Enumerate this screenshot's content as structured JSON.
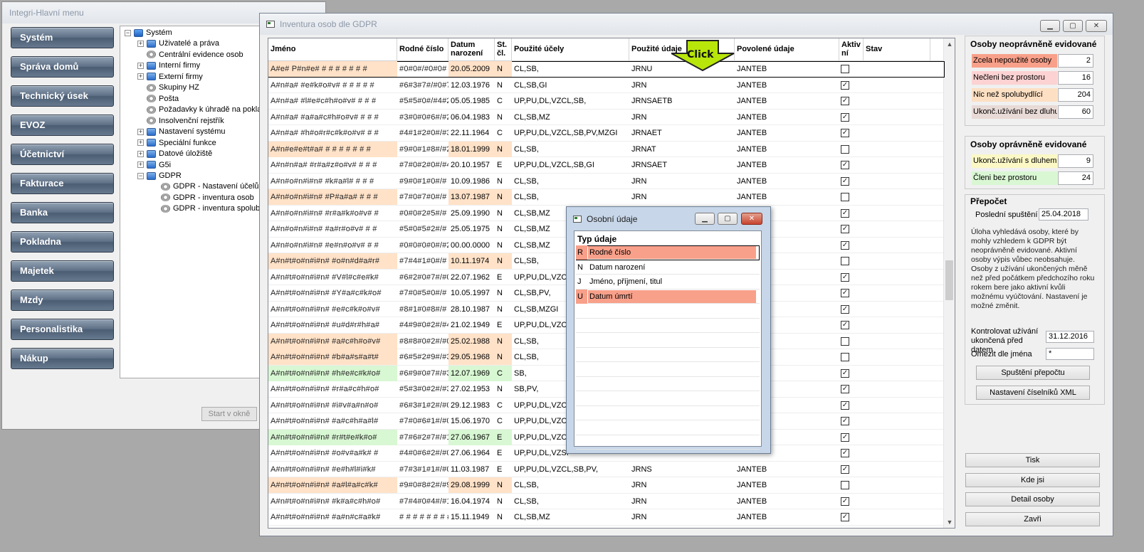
{
  "main_window": {
    "title": "Integri-Hlavní menu",
    "nav_buttons": [
      "Systém",
      "Správa domů",
      "Technický úsek",
      "EVOZ",
      "Účetnictví",
      "Fakturace",
      "Banka",
      "Pokladna",
      "Majetek",
      "Mzdy",
      "Personalistika",
      "Nákup"
    ],
    "tree": {
      "root": "Systém",
      "items": [
        "Uživatelé a práva",
        "Centrální evidence osob",
        "Interní firmy",
        "Externí firmy",
        "Skupiny HZ",
        "Pošta",
        "Požadavky k úhradě na pokla",
        "Insolvenční rejstřík",
        "Nastavení systému",
        "Speciální funkce",
        "Datové úložiště",
        "G5i",
        "GDPR"
      ],
      "gdpr_children": [
        "GDPR - Nastavení účelů",
        "GDPR - inventura osob",
        "GDPR - inventura spoluby"
      ]
    },
    "start_button": "Start v okně"
  },
  "gdpr_window": {
    "title": "Inventura osob dle GDPR",
    "columns": {
      "jmeno": "Jméno",
      "rodne_cislo": "Rodné číslo",
      "datum_narozeni": "Datum\nnarození",
      "st_cl": "St.\nčl.",
      "pouzite_ucely": "Použité účely",
      "pouzite_udaje": "Použité údaje",
      "povolene_udaje": "Povolené údaje",
      "aktivni": "Aktiv\nní",
      "stav": "Stav"
    },
    "rows": [
      {
        "jmeno": "A#e# P#n#e# # # # # # # #",
        "rc": "#0#0#/#0#0#",
        "datum": "20.05.2009",
        "st": "N",
        "ucely": "CL,SB,",
        "udaje": "JRNU",
        "povolene": "JANTEB",
        "aktivni": false,
        "bg": "orange"
      },
      {
        "jmeno": "A#n#a# #e#k#o#v# # # # # #",
        "rc": "#6#3#7#/#0#7#",
        "datum": "12.03.1976",
        "st": "N",
        "ucely": "CL,SB,GI",
        "udaje": "JRN",
        "povolene": "JANTEB",
        "aktivni": true,
        "bg": ""
      },
      {
        "jmeno": "A#n#a# #l#e#c#h#o#v# # # #",
        "rc": "#5#5#0#/#4#2#",
        "datum": "05.05.1985",
        "st": "C",
        "ucely": "UP,PU,DL,VZCL,SB,",
        "udaje": "JRNSAETB",
        "povolene": "JANTEB",
        "aktivni": true,
        "bg": ""
      },
      {
        "jmeno": "A#n#a# #a#a#c#h#o#v# # # #",
        "rc": "#3#0#0#6#/#2#3#",
        "datum": "06.04.1983",
        "st": "N",
        "ucely": "CL,SB,MZ",
        "udaje": "JRN",
        "povolene": "JANTEB",
        "aktivni": true,
        "bg": ""
      },
      {
        "jmeno": "A#n#a# #h#o#r#c#k#o#v# # #",
        "rc": "#4#1#2#0#/#3#1#",
        "datum": "22.11.1964",
        "st": "C",
        "ucely": "UP,PU,DL,VZCL,SB,PV,MZGI",
        "udaje": "JRNAET",
        "povolene": "JANTEB",
        "aktivni": true,
        "bg": ""
      },
      {
        "jmeno": "A#n#e#e#t#a# # # # # # # #",
        "rc": "#9#0#1#8#/#2#9#",
        "datum": "18.01.1999",
        "st": "N",
        "ucely": "CL,SB,",
        "udaje": "JRNAT",
        "povolene": "JANTEB",
        "aktivni": false,
        "bg": "orange"
      },
      {
        "jmeno": "A#n#n#a# #r#a#z#o#v# # # #",
        "rc": "#7#0#2#0#/#4#9#",
        "datum": "20.10.1957",
        "st": "E",
        "ucely": "UP,PU,DL,VZCL,SB,GI",
        "udaje": "JRNSAET",
        "povolene": "JANTEB",
        "aktivni": true,
        "bg": ""
      },
      {
        "jmeno": "A#n#o#n#i#n# #k#a#l# # # #",
        "rc": "#9#0#1#0#/# # #",
        "datum": "10.09.1986",
        "st": "N",
        "ucely": "CL,SB,",
        "udaje": "JRN",
        "povolene": "JANTEB",
        "aktivni": true,
        "bg": ""
      },
      {
        "jmeno": "A#n#o#n#i#n# #P#a#a# # # #",
        "rc": "#7#0#7#0#/# # #",
        "datum": "13.07.1987",
        "st": "N",
        "ucely": "CL,SB,",
        "udaje": "JRN",
        "povolene": "JANTEB",
        "aktivni": false,
        "bg": "orange"
      },
      {
        "jmeno": "A#n#o#n#i#n# #r#a#k#o#v# #",
        "rc": "#0#0#2#5#/# # #",
        "datum": "25.09.1990",
        "st": "N",
        "ucely": "CL,SB,MZ",
        "udaje": "",
        "povolene": "",
        "aktivni": true,
        "bg": ""
      },
      {
        "jmeno": "A#n#o#n#i#n# #a#r#o#v# # #",
        "rc": "#5#0#5#2#/# # #",
        "datum": "25.05.1975",
        "st": "N",
        "ucely": "CL,SB,MZ",
        "udaje": "",
        "povolene": "",
        "aktivni": true,
        "bg": ""
      },
      {
        "jmeno": "A#n#o#n#i#n# #e#n#o#v# # #",
        "rc": "#0#0#0#0#/#2#3#",
        "datum": "00.00.0000",
        "st": "N",
        "ucely": "CL,SB,MZ",
        "udaje": "",
        "povolene": "",
        "aktivni": true,
        "bg": ""
      },
      {
        "jmeno": "A#n#t#o#n#i#n# #o#n#d#a#r#",
        "rc": "#7#4#1#0#/# # #",
        "datum": "10.11.1974",
        "st": "N",
        "ucely": "CL,SB,",
        "udaje": "",
        "povolene": "",
        "aktivni": false,
        "bg": "orange"
      },
      {
        "jmeno": "A#n#t#o#n#i#n# #V#l#c#e#k#",
        "rc": "#6#2#0#7#/#0#4#",
        "datum": "22.07.1962",
        "st": "E",
        "ucely": "UP,PU,DL,VZCL",
        "udaje": "",
        "povolene": "",
        "aktivni": true,
        "bg": ""
      },
      {
        "jmeno": "A#n#t#o#n#i#n# #Y#a#c#k#o#",
        "rc": "#7#0#5#0#/# # #",
        "datum": "10.05.1997",
        "st": "N",
        "ucely": "CL,SB,PV,",
        "udaje": "",
        "povolene": "",
        "aktivni": true,
        "bg": ""
      },
      {
        "jmeno": "A#n#t#o#n#i#n# #e#c#k#o#v#",
        "rc": "#8#1#0#8#/# # #",
        "datum": "28.10.1987",
        "st": "N",
        "ucely": "CL,SB,MZGI",
        "udaje": "",
        "povolene": "",
        "aktivni": true,
        "bg": ""
      },
      {
        "jmeno": "A#n#t#o#n#i#n# #u#d#r#h#a#",
        "rc": "#4#9#0#2#/#4#3#",
        "datum": "21.02.1949",
        "st": "E",
        "ucely": "UP,PU,DL,VZCL",
        "udaje": "",
        "povolene": "",
        "aktivni": true,
        "bg": ""
      },
      {
        "jmeno": "A#n#t#o#n#i#n# #a#c#h#o#v#",
        "rc": "#8#8#0#2#/#0#7#",
        "datum": "25.02.1988",
        "st": "N",
        "ucely": "CL,SB,",
        "udaje": "",
        "povolene": "",
        "aktivni": false,
        "bg": "orange"
      },
      {
        "jmeno": "A#n#t#o#n#i#n# #b#a#s#a#t#",
        "rc": "#6#5#2#9#/#3#9#",
        "datum": "29.05.1968",
        "st": "N",
        "ucely": "CL,SB,",
        "udaje": "",
        "povolene": "",
        "aktivni": false,
        "bg": "orange"
      },
      {
        "jmeno": "A#n#t#o#n#i#n# #h#e#c#k#o#",
        "rc": "#6#9#0#7#/#3#7#",
        "datum": "12.07.1969",
        "st": "C",
        "ucely": "SB,",
        "udaje": "",
        "povolene": "",
        "aktivni": true,
        "bg": "green"
      },
      {
        "jmeno": "A#n#t#o#n#i#n# #r#a#c#h#o#",
        "rc": "#5#3#0#2#/#3#7#",
        "datum": "27.02.1953",
        "st": "N",
        "ucely": "SB,PV,",
        "udaje": "",
        "povolene": "",
        "aktivni": true,
        "bg": ""
      },
      {
        "jmeno": "A#n#t#o#n#i#n# #i#v#a#n#o#",
        "rc": "#6#3#1#2#/#0#4#4#",
        "datum": "29.12.1983",
        "st": "C",
        "ucely": "UP,PU,DL,VZCL",
        "udaje": "",
        "povolene": "",
        "aktivni": true,
        "bg": ""
      },
      {
        "jmeno": "A#n#t#o#n#i#n# #a#c#h#a#l#",
        "rc": "#7#0#6#1#/#0#3#",
        "datum": "15.06.1970",
        "st": "C",
        "ucely": "UP,PU,DL,VZCL",
        "udaje": "",
        "povolene": "",
        "aktivni": true,
        "bg": ""
      },
      {
        "jmeno": "A#n#t#o#n#i#n# #r#t#e#k#o#",
        "rc": "#7#6#2#7#/#1#5#",
        "datum": "27.06.1967",
        "st": "E",
        "ucely": "UP,PU,DL,VZCL",
        "udaje": "",
        "povolene": "",
        "aktivni": true,
        "bg": "green"
      },
      {
        "jmeno": "A#n#t#o#n#i#n# #o#v#a#k# #",
        "rc": "#4#0#6#2#/#0#4#",
        "datum": "27.06.1964",
        "st": "E",
        "ucely": "UP,PU,DL,VZSI",
        "udaje": "",
        "povolene": "",
        "aktivni": true,
        "bg": ""
      },
      {
        "jmeno": "A#n#t#o#n#i#n# #e#h#l#i#k#",
        "rc": "#7#3#1#1#/#0#1#",
        "datum": "11.03.1987",
        "st": "E",
        "ucely": "UP,PU,DL,VZCL,SB,PV,",
        "udaje": "JRNS",
        "povolene": "JANTEB",
        "aktivni": true,
        "bg": ""
      },
      {
        "jmeno": "A#n#t#o#n#i#n# #a#l#a#c#k#",
        "rc": "#9#0#8#2#/#9#",
        "datum": "29.08.1999",
        "st": "N",
        "ucely": "CL,SB,",
        "udaje": "JRN",
        "povolene": "JANTEB",
        "aktivni": false,
        "bg": "orange"
      },
      {
        "jmeno": "A#n#t#o#n#i#n# #k#a#c#h#o#",
        "rc": "#7#4#0#4#/#1#0#",
        "datum": "16.04.1974",
        "st": "N",
        "ucely": "CL,SB,",
        "udaje": "JRN",
        "povolene": "JANTEB",
        "aktivni": true,
        "bg": ""
      },
      {
        "jmeno": "A#n#t#o#n#i#n# #a#n#c#a#k#",
        "rc": "# # # # # # # #",
        "datum": "15.11.1949",
        "st": "N",
        "ucely": "CL,SB,MZ",
        "udaje": "JRN",
        "povolene": "JANTEB",
        "aktivni": true,
        "bg": ""
      }
    ],
    "annotation": "Click",
    "right_panel": {
      "neopravnene_title": "Osoby neoprávněně evidované",
      "neopravnene": [
        {
          "label": "Zcela nepoužité osoby",
          "value": "2",
          "color": "#f8a08a"
        },
        {
          "label": "Nečleni bez prostoru",
          "value": "16",
          "color": "#fcd2d2"
        },
        {
          "label": "Nic než spolubydlící",
          "value": "204",
          "color": "#fde0c3"
        },
        {
          "label": "Ukonč.užívání bez dluhu",
          "value": "60",
          "color": "#e8dad6"
        }
      ],
      "opravnene_title": "Osoby oprávněně evidované",
      "opravnene": [
        {
          "label": "Ukonč.užívání s dluhem",
          "value": "9",
          "color": "#fbf8c6"
        },
        {
          "label": "Členi bez prostoru",
          "value": "24",
          "color": "#d9f7d3"
        }
      ],
      "prepocet_title": "Přepočet",
      "posledni_label": "Poslední spuštění",
      "posledni_value": "25.04.2018",
      "note": "Úloha vyhledává osoby, které by mohly vzhledem k GDPR být neoprávněně evidované. Aktivní osoby výpis vůbec neobsahuje. Osoby z užívání ukončených měně než před počátkem předchozího roku rokem bere jako aktivní kvůli možnému vyúčtování. Nastavení je možné změnit.",
      "kontrolovat_label": "Kontrolovat užívání ukončená před datem",
      "kontrolovat_value": "31.12.2016",
      "omezit_label": "Omezit dle jména",
      "omezit_value": "*",
      "spusteni_button": "Spuštění přepočtu",
      "nastaveni_button": "Nastavení číselníků XML",
      "bottom_buttons": [
        "Tisk",
        "Kde jsi",
        "Detail osoby",
        "Zavři"
      ]
    }
  },
  "dialog": {
    "title": "Osobní údaje",
    "header": "Typ údaje",
    "rows": [
      {
        "code": "R",
        "name": "Rodné číslo",
        "highlight": true,
        "selected": true
      },
      {
        "code": "N",
        "name": "Datum narození",
        "highlight": false,
        "selected": false
      },
      {
        "code": "J",
        "name": "Jméno, příjmení, titul",
        "highlight": false,
        "selected": false
      },
      {
        "code": "U",
        "name": "Datum úmrtí",
        "highlight": true,
        "selected": false
      }
    ]
  }
}
